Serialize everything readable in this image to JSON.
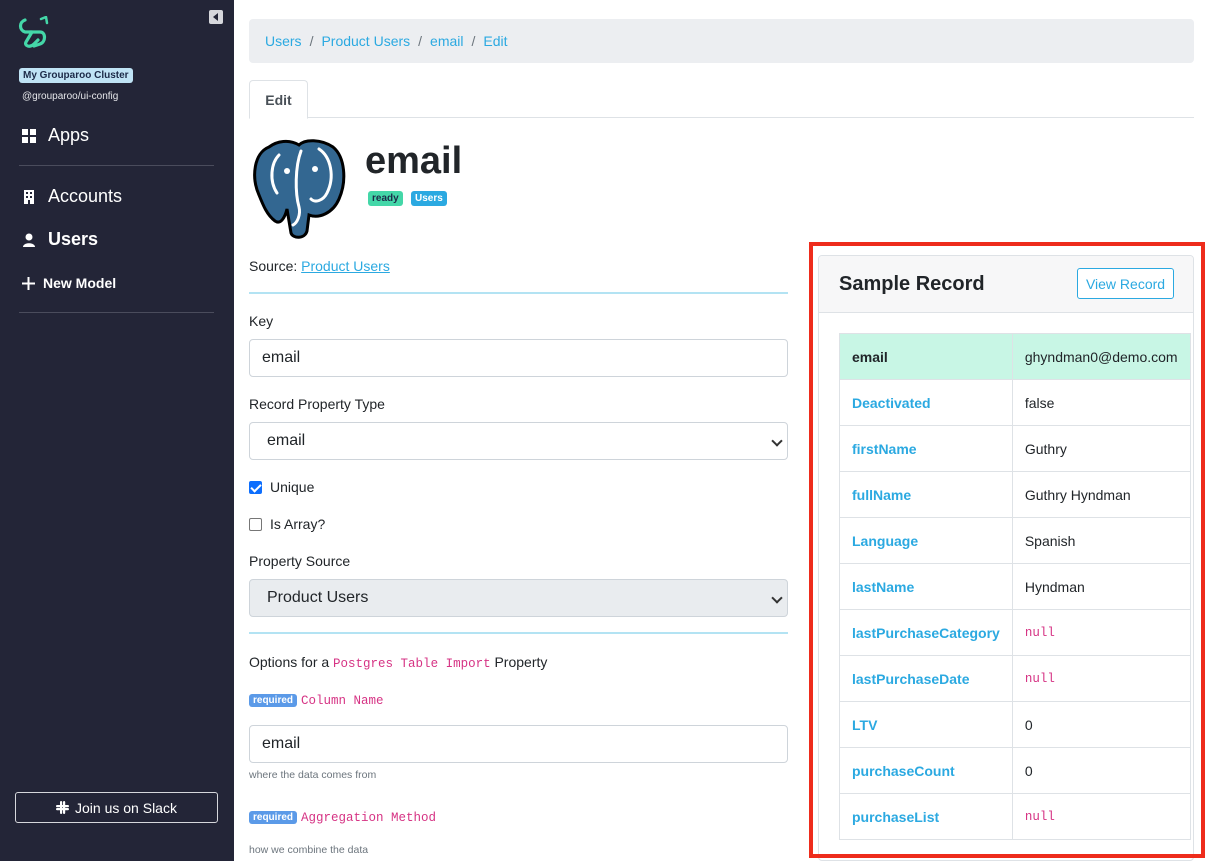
{
  "sidebar": {
    "cluster_name": "My Grouparoo Cluster",
    "config_name": "@grouparoo/ui-config",
    "apps_label": "Apps",
    "accounts_label": "Accounts",
    "users_label": "Users",
    "new_model_label": "New Model",
    "slack_label": "Join us on Slack"
  },
  "breadcrumb": [
    "Users",
    "Product Users",
    "email",
    "Edit"
  ],
  "tabs": {
    "edit": "Edit"
  },
  "property": {
    "title": "email",
    "state_badge": "ready",
    "model_badge": "Users",
    "source_label": "Source:",
    "source_link": "Product Users"
  },
  "form": {
    "key_label": "Key",
    "key_value": "email",
    "type_label": "Record Property Type",
    "type_value": "email",
    "unique_label": "Unique",
    "unique_checked": true,
    "array_label": "Is Array?",
    "array_checked": false,
    "source_label": "Property Source",
    "source_value": "Product Users",
    "options_prefix": "Options for a",
    "options_plugin": "Postgres Table Import",
    "options_suffix": "Property",
    "required_badge": "required",
    "column_name_label": "Column Name",
    "column_name_value": "email",
    "column_name_help": "where the data comes from",
    "aggregation_label": "Aggregation Method",
    "aggregation_help": "how we combine the data"
  },
  "sample_record": {
    "title": "Sample Record",
    "view_button": "View Record",
    "rows": [
      {
        "key": "email",
        "value": "ghyndman0@demo.com",
        "null": false
      },
      {
        "key": "Deactivated",
        "value": "false",
        "null": false
      },
      {
        "key": "firstName",
        "value": "Guthry",
        "null": false
      },
      {
        "key": "fullName",
        "value": "Guthry Hyndman",
        "null": false
      },
      {
        "key": "Language",
        "value": "Spanish",
        "null": false
      },
      {
        "key": "lastName",
        "value": "Hyndman",
        "null": false
      },
      {
        "key": "lastPurchaseCategory",
        "value": "null",
        "null": true
      },
      {
        "key": "lastPurchaseDate",
        "value": "null",
        "null": true
      },
      {
        "key": "LTV",
        "value": "0",
        "null": false
      },
      {
        "key": "purchaseCount",
        "value": "0",
        "null": false
      },
      {
        "key": "purchaseList",
        "value": "null",
        "null": true
      }
    ]
  },
  "colors": {
    "sidebar_bg": "#232537",
    "accent": "#2ba9e1",
    "highlight_border": "#ee2c1c",
    "primary_row": "#c8f6e5"
  }
}
